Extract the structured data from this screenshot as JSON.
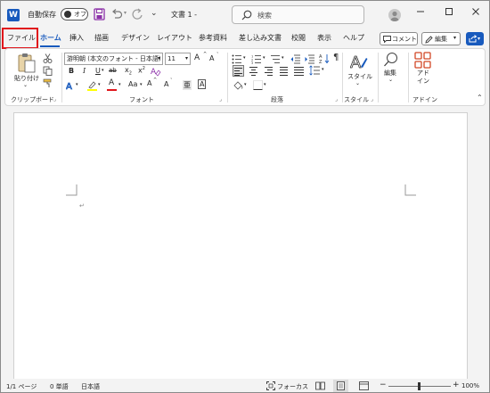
{
  "titlebar": {
    "app_icon": "W",
    "autosave_label": "自動保存",
    "autosave_state": "オフ",
    "doc_title": "文書 1  -",
    "search_placeholder": "検索",
    "icons": [
      "word-logo-icon",
      "save-icon",
      "undo-icon",
      "redo-icon",
      "customize-qat-icon",
      "search-icon",
      "user-avatar-icon",
      "minimize-icon",
      "maximize-icon",
      "close-icon"
    ]
  },
  "tabs": [
    "ファイル",
    "ホーム",
    "挿入",
    "描画",
    "デザイン",
    "レイアウト",
    "参考資料",
    "差し込み文書",
    "校閲",
    "表示",
    "ヘルプ"
  ],
  "tab_actions": {
    "comment": "コメント",
    "edit": "編集",
    "share_icon": "share-icon"
  },
  "ribbon": {
    "clipboard": {
      "paste": "貼り付け",
      "label": "クリップボード"
    },
    "font": {
      "font_name": "游明朝 (本文のフォント - 日本語)",
      "font_size": "11",
      "label": "フォント",
      "bold": "B",
      "italic": "I",
      "underline": "U",
      "strike": "ab",
      "subscript": "x",
      "superscript": "x",
      "grow": "A",
      "shrink": "A",
      "case": "Aa",
      "color_a": "A",
      "clear_format": "A",
      "phonetic": "亜",
      "enclose": "A"
    },
    "paragraph": {
      "label": "段落"
    },
    "styles": {
      "button": "スタイル",
      "label": "スタイル"
    },
    "editing": {
      "button": "編集"
    },
    "addins": {
      "button": "アド\nイン",
      "label": "アドイン"
    }
  },
  "colors": {
    "accent": "#185abd",
    "highlight": "#ffff00",
    "font_color": "#e0151b",
    "file_box": "#e0151b"
  },
  "statusbar": {
    "page": "1/1 ページ",
    "words": "0 単語",
    "language": "日本語",
    "focus": "フォーカス",
    "zoom_minus": "−",
    "zoom_plus": "+",
    "zoom": "100%"
  }
}
